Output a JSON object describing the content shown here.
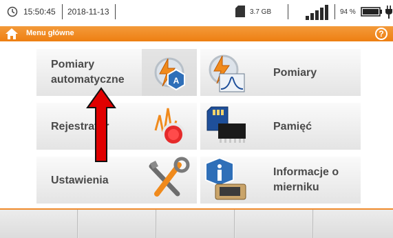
{
  "status_bar": {
    "time": "15:50:45",
    "date": "2018-11-13",
    "memory": "3.7 GB",
    "battery_percent": "94 %"
  },
  "header": {
    "title": "Menu główne",
    "help_symbol": "?",
    "color": "#ef8a2a"
  },
  "menu": [
    {
      "label_line1": "Pomiary",
      "label_line2": "automatyczne",
      "icon": "auto-measure-icon"
    },
    {
      "label_line1": "Pomiary",
      "label_line2": "",
      "icon": "measure-icon"
    },
    {
      "label_line1": "Rejestrator",
      "label_line2": "",
      "icon": "recorder-icon"
    },
    {
      "label_line1": "Pamięć",
      "label_line2": "",
      "icon": "memory-card-icon"
    },
    {
      "label_line1": "Ustawienia",
      "label_line2": "",
      "icon": "tools-icon"
    },
    {
      "label_line1": "Informacje o",
      "label_line2": "mierniku",
      "icon": "meter-info-icon"
    }
  ],
  "function_keys": [
    "",
    "",
    "",
    "",
    ""
  ],
  "colors": {
    "accent": "#ef8a2a",
    "arrow": "#e00000",
    "tile_text": "#4a4a4a"
  }
}
